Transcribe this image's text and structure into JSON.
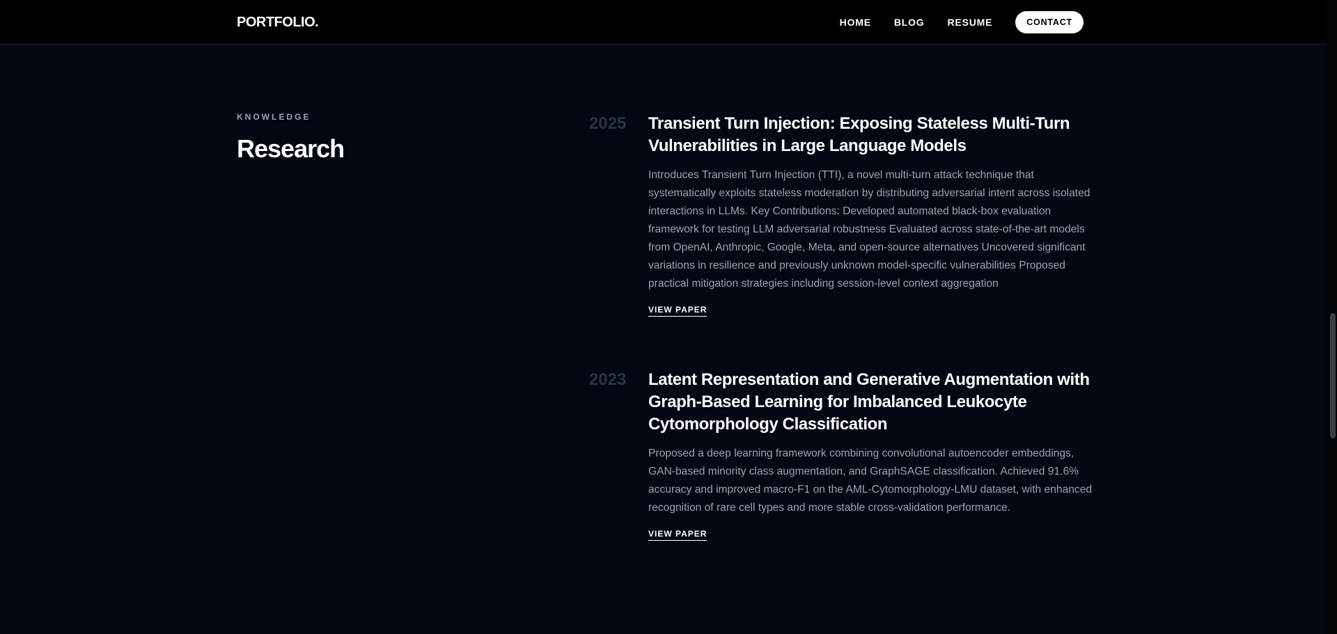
{
  "nav": {
    "logo": "PORTFOLIO.",
    "links": [
      "HOME",
      "BLOG",
      "RESUME"
    ],
    "contact_label": "CONTACT"
  },
  "section": {
    "eyebrow": "KNOWLEDGE",
    "title": "Research"
  },
  "entries": [
    {
      "year": "2025",
      "title": "Transient Turn Injection: Exposing Stateless Multi-Turn Vulnerabilities in Large Language Models",
      "description": "Introduces Transient Turn Injection (TTI), a novel multi-turn attack technique that systematically exploits stateless moderation by distributing adversarial intent across isolated interactions in LLMs. Key Contributions: Developed automated black-box evaluation framework for testing LLM adversarial robustness Evaluated across state-of-the-art models from OpenAI, Anthropic, Google, Meta, and open-source alternatives Uncovered significant variations in resilience and previously unknown model-specific vulnerabilities Proposed practical mitigation strategies including session-level context aggregation",
      "link_label": "VIEW PAPER"
    },
    {
      "year": "2023",
      "title": "Latent Representation and Generative Augmentation with Graph-Based Learning for Imbalanced Leukocyte Cytomorphology Classification",
      "description": "Proposed a deep learning framework combining convolutional autoencoder embeddings, GAN-based minority class augmentation, and GraphSAGE classification. Achieved 91.6% accuracy and improved macro-F1 on the AML-Cytomorphology-LMU dataset, with enhanced recognition of rare cell types and more stable cross-validation performance.",
      "link_label": "VIEW PAPER"
    }
  ]
}
